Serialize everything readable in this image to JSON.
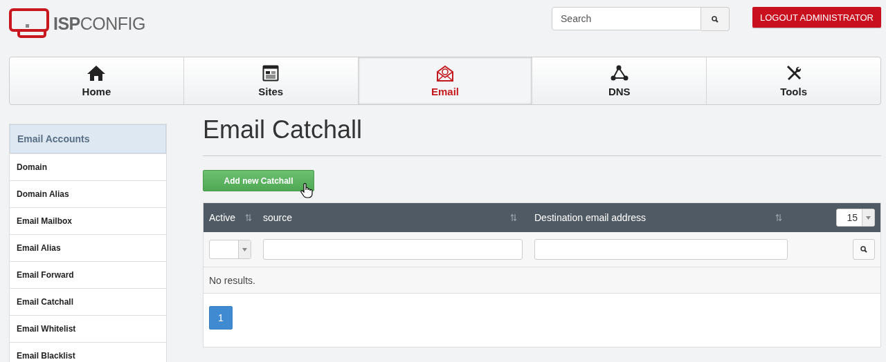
{
  "logo": {
    "text": "**ISP**CONFIG"
  },
  "search": {
    "placeholder": "Search"
  },
  "logout_button": "LOGOUT ADMINISTRATOR",
  "nav_tabs": [
    {
      "label": "Home",
      "kind": "home",
      "selected": false
    },
    {
      "label": "Sites",
      "kind": "sites",
      "selected": false
    },
    {
      "label": "Email",
      "kind": "email",
      "selected": true
    },
    {
      "label": "DNS",
      "kind": "dns",
      "selected": false
    },
    {
      "label": "Tools",
      "kind": "tools",
      "selected": false
    }
  ],
  "sidebar": {
    "heading": "Email Accounts",
    "items": [
      {
        "label": "Domain",
        "selected": false
      },
      {
        "label": "Domain Alias",
        "selected": false
      },
      {
        "label": "Email Mailbox",
        "selected": false
      },
      {
        "label": "Email Alias",
        "selected": false
      },
      {
        "label": "Email Forward",
        "selected": false
      },
      {
        "label": "Email Catchall",
        "selected": false
      },
      {
        "label": "Email Whitelist",
        "selected": false
      },
      {
        "label": "Email Blacklist",
        "selected": false
      }
    ]
  },
  "page_title": "Email Catchall",
  "add_button": "Add new Catchall",
  "table": {
    "columns": [
      {
        "label": "Active",
        "sortable": true
      },
      {
        "label": "source",
        "sortable": true
      },
      {
        "label": "Destination email address",
        "sortable": true
      }
    ],
    "page_size": "15",
    "empty_message": "No results."
  },
  "pagination": [
    {
      "label": "1",
      "selected": true
    }
  ]
}
